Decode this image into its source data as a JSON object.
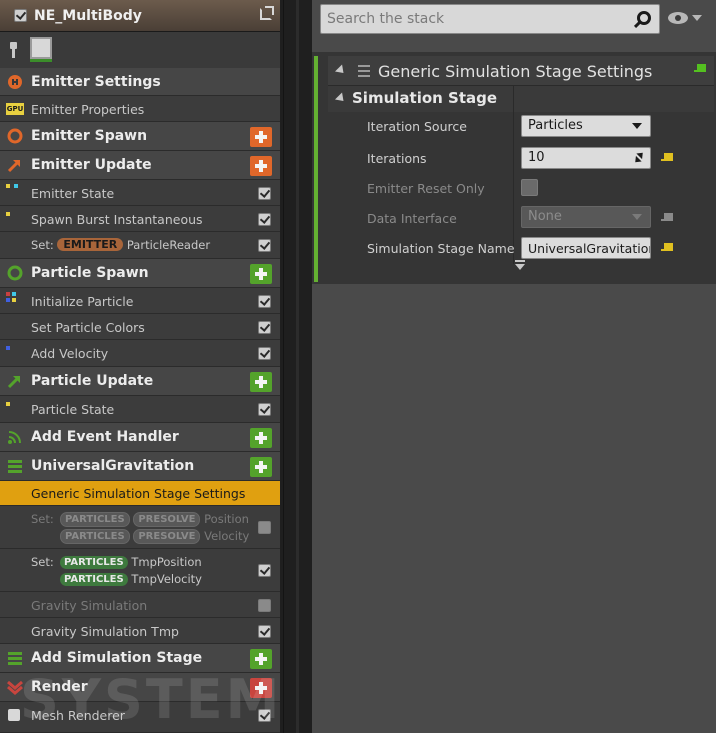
{
  "colors": {
    "accent_selected": "#e0a010",
    "add_orange": "#e0672a",
    "add_green": "#54a32b",
    "add_red": "#c8453e",
    "emitter_pill": "#a8653a",
    "particles_pill": "#3e7a3e",
    "stage_bar": "#64b032"
  },
  "header": {
    "title": "NE_MultiBody",
    "enabled": true,
    "popout_icon": "popout-icon"
  },
  "toolbar": {
    "pin_icon": "pin-icon",
    "thumbnail_icon": "emitter-thumbnail-icon"
  },
  "stack": {
    "emitter_settings": {
      "label": "Emitter Settings",
      "icon": "emitter-settings-icon"
    },
    "emitter_properties": {
      "label": "Emitter Properties",
      "icon": "gpu-icon",
      "icon_text": "GPU"
    },
    "emitter_spawn": {
      "label": "Emitter Spawn",
      "icon": "emitter-spawn-icon"
    },
    "emitter_update": {
      "label": "Emitter Update",
      "icon": "emitter-update-icon"
    },
    "emitter_state": {
      "label": "Emitter State",
      "checked": true
    },
    "spawn_burst": {
      "label": "Spawn Burst Instantaneous",
      "checked": true
    },
    "set_emitter": {
      "prefix": "Set:",
      "namespace": "EMITTER",
      "param": "ParticleReader",
      "checked": true
    },
    "particle_spawn": {
      "label": "Particle Spawn",
      "icon": "particle-spawn-icon"
    },
    "initialize_particle": {
      "label": "Initialize Particle",
      "checked": true
    },
    "set_particle_colors": {
      "label": "Set Particle Colors",
      "checked": true
    },
    "add_velocity": {
      "label": "Add Velocity",
      "checked": true
    },
    "particle_update": {
      "label": "Particle Update",
      "icon": "particle-update-icon"
    },
    "particle_state": {
      "label": "Particle State",
      "checked": true
    },
    "add_event_handler": {
      "label": "Add Event Handler",
      "icon": "event-handler-icon"
    },
    "universal_gravitation": {
      "label": "UniversalGravitation",
      "icon": "sim-stage-icon"
    },
    "generic_settings": {
      "label": "Generic Simulation Stage Settings"
    },
    "set_presolve": {
      "prefix": "Set:",
      "ns1": "PARTICLES",
      "ns2": "PRESOLVE",
      "param1": "Position",
      "param2": "Velocity",
      "checked": false
    },
    "set_tmp": {
      "prefix": "Set:",
      "ns": "PARTICLES",
      "param1": "TmpPosition",
      "param2": "TmpVelocity",
      "checked": true
    },
    "gravity_sim": {
      "label": "Gravity Simulation",
      "checked": false
    },
    "gravity_sim_tmp": {
      "label": "Gravity Simulation Tmp",
      "checked": true
    },
    "add_sim_stage": {
      "label": "Add Simulation Stage",
      "icon": "sim-stage-icon"
    },
    "render": {
      "label": "Render",
      "icon": "render-icon"
    },
    "mesh_renderer": {
      "label": "Mesh Renderer",
      "checked": true,
      "icon": "mesh-icon"
    },
    "watermark": "SYSTEM"
  },
  "details": {
    "search_placeholder": "Search the stack",
    "card_title": "Generic Simulation Stage Settings",
    "section_title": "Simulation Stage",
    "props": {
      "iteration_source": {
        "label": "Iteration Source",
        "value": "Particles"
      },
      "iterations": {
        "label": "Iterations",
        "value": "10"
      },
      "emitter_reset_only": {
        "label": "Emitter Reset Only",
        "checked": false
      },
      "data_interface": {
        "label": "Data Interface",
        "value": "None"
      },
      "sim_stage_name": {
        "label": "Simulation Stage Name",
        "value": "UniversalGravitation"
      }
    }
  }
}
